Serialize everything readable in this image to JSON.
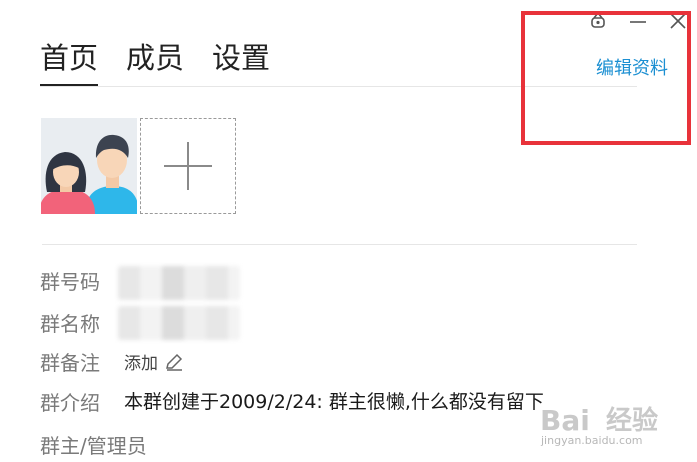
{
  "tabs": [
    {
      "label": "首页",
      "active": true
    },
    {
      "label": "成员",
      "active": false
    },
    {
      "label": "设置",
      "active": false
    }
  ],
  "header": {
    "edit_profile_label": "编辑资料"
  },
  "window_controls": [
    "pin-icon",
    "minimize-icon",
    "close-icon"
  ],
  "info": {
    "group_id_label": "群号码",
    "group_name_label": "群名称",
    "group_note_label": "群备注",
    "group_note_action": "添加",
    "group_intro_label": "群介绍",
    "group_intro_value": "本群创建于2009/2/24:  群主很懒,什么都没有留下",
    "group_admin_label": "群主/管理员"
  },
  "watermark": {
    "text": "经验",
    "url": "jingyan.baidu.com"
  },
  "colors": {
    "accent": "#1b8fd2",
    "highlight": "#e8323a"
  }
}
